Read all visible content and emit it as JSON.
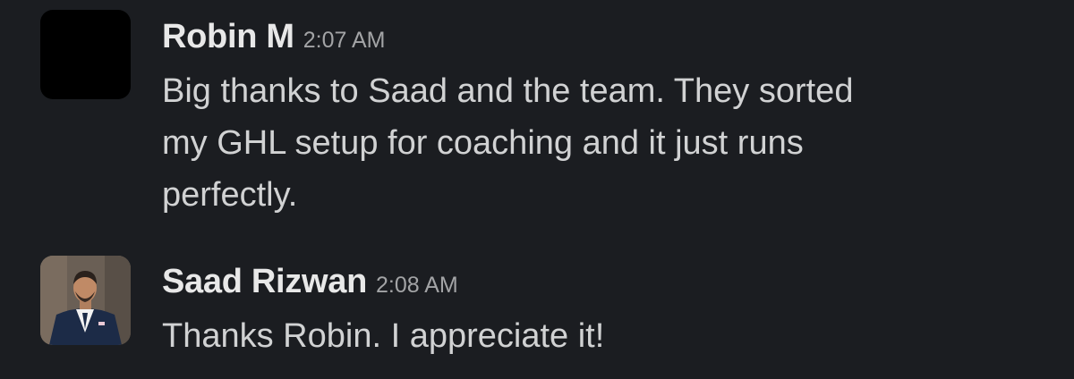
{
  "messages": [
    {
      "author": "Robin M",
      "time": "2:07 AM",
      "avatar": "dark-square-avatar",
      "lines": [
        "Big thanks to Saad and the team. They sorted",
        "my GHL setup for coaching and it just runs",
        "perfectly."
      ]
    },
    {
      "author": "Saad Rizwan",
      "time": "2:08 AM",
      "avatar": "profile-photo-avatar",
      "lines": [
        "Thanks Robin. I appreciate it!"
      ]
    }
  ],
  "colors": {
    "background": "#1b1d21",
    "author_text": "#e8e8e8",
    "body_text": "#d1d2d3",
    "timestamp_text": "#a3a4a6"
  }
}
